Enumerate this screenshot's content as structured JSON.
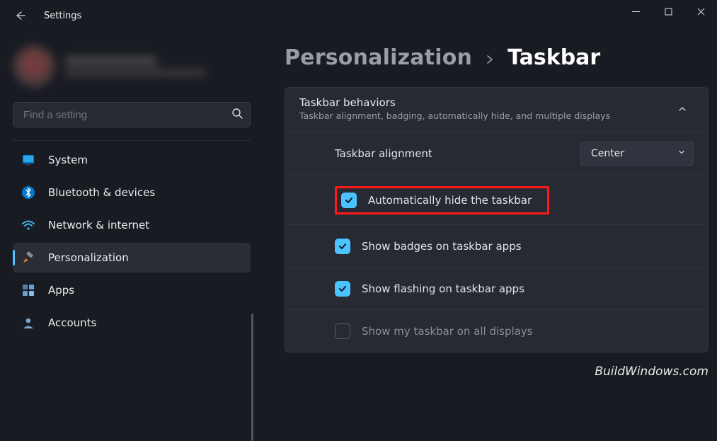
{
  "app": {
    "title": "Settings"
  },
  "search": {
    "placeholder": "Find a setting"
  },
  "sidebar": {
    "items": [
      {
        "label": "System"
      },
      {
        "label": "Bluetooth & devices"
      },
      {
        "label": "Network & internet"
      },
      {
        "label": "Personalization"
      },
      {
        "label": "Apps"
      },
      {
        "label": "Accounts"
      }
    ]
  },
  "breadcrumb": {
    "parent": "Personalization",
    "current": "Taskbar"
  },
  "card": {
    "title": "Taskbar behaviors",
    "subtitle": "Taskbar alignment, badging, automatically hide, and multiple displays"
  },
  "rows": {
    "alignment_label": "Taskbar alignment",
    "alignment_value": "Center",
    "auto_hide": "Automatically hide the taskbar",
    "badges": "Show badges on taskbar apps",
    "flashing": "Show flashing on taskbar apps",
    "all_displays": "Show my taskbar on all displays"
  },
  "watermark": "BuildWindows.com"
}
